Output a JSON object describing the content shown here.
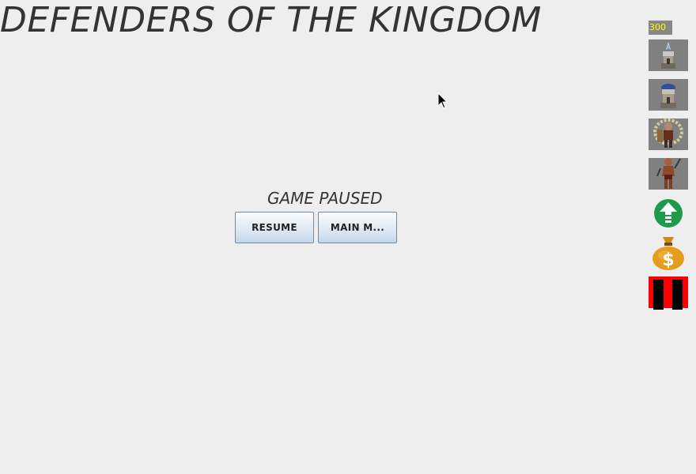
{
  "title": "DEFENDERS OF THE KINGDOM",
  "pause_menu": {
    "label": "GAME PAUSED",
    "resume_button": "RESUME",
    "main_menu_button": "MAIN M..."
  },
  "sidebar": {
    "gold": "300",
    "tools": [
      {
        "icon": "mage-tower-icon"
      },
      {
        "icon": "archer-tower-icon"
      },
      {
        "icon": "warrior-unit-icon"
      },
      {
        "icon": "barbarian-unit-icon"
      },
      {
        "icon": "upgrade-arrow-icon"
      },
      {
        "icon": "money-bag-icon"
      },
      {
        "icon": "pause-icon"
      }
    ]
  },
  "colors": {
    "background": "#eeeeee",
    "gold_text": "#ffff00",
    "pause_red": "#ff0000",
    "upgrade_green": "#1e9a4a"
  }
}
